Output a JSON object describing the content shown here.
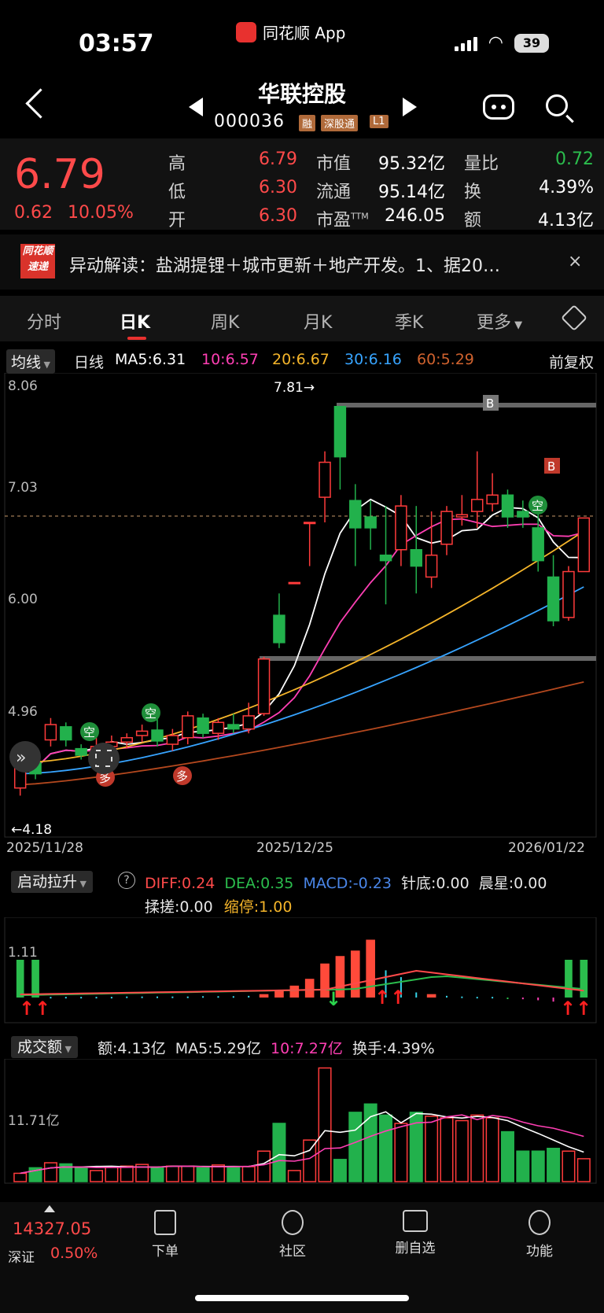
{
  "status_bar": {
    "time": "03:57",
    "app_name": "同花顺 App",
    "battery": "39"
  },
  "header": {
    "stock_name": "华联控股",
    "stock_code": "000036",
    "tags": [
      "融",
      "深股通",
      "L1"
    ]
  },
  "quote": {
    "price": "6.79",
    "change": "0.62",
    "change_pct": "10.05%",
    "fields": [
      {
        "label": "高",
        "value": "6.79",
        "color": "red"
      },
      {
        "label": "低",
        "value": "6.30",
        "color": "red"
      },
      {
        "label": "开",
        "value": "6.30",
        "color": "red"
      },
      {
        "label": "市值",
        "value": "95.32亿",
        "color": "white"
      },
      {
        "label": "流通",
        "value": "95.14亿",
        "color": "white"
      },
      {
        "label": "市盈",
        "sup": "TTM",
        "value": "246.05",
        "color": "white"
      },
      {
        "label": "量比",
        "value": "0.72",
        "color": "green"
      },
      {
        "label": "换",
        "value": "4.39%",
        "color": "white"
      },
      {
        "label": "额",
        "value": "4.13亿",
        "color": "white"
      }
    ]
  },
  "news": {
    "logo_top": "同花顺",
    "logo_bottom": "速递",
    "text": "异动解读：盐湖提锂＋城市更新＋地产开发。1、据20…",
    "close": "×"
  },
  "tabs": [
    "分时",
    "日K",
    "周K",
    "月K",
    "季K",
    "更多"
  ],
  "ma_row": {
    "mode": "均线",
    "period": "日线",
    "ma5": "MA5:6.31",
    "ma10": "10:6.57",
    "ma20": "20:6.67",
    "ma30": "30:6.16",
    "ma60": "60:5.29",
    "adjust": "前复权"
  },
  "kline": {
    "y_labels": [
      "8.06",
      "7.03",
      "6.00",
      "4.96"
    ],
    "high_mark": "7.81→",
    "low_mark": "←4.18",
    "x_labels": [
      "2025/11/28",
      "2025/12/25",
      "2026/01/22"
    ],
    "signals": [
      "空",
      "空",
      "多",
      "多",
      "空",
      "B",
      "B"
    ]
  },
  "chart_data": [
    {
      "type": "candlestick",
      "title": "日K",
      "x": [
        "2025/11/28",
        "2025/12/25",
        "2026/01/22"
      ],
      "ylim": [
        3.9,
        8.06
      ],
      "candles": [
        [
          4.32,
          4.55,
          4.25,
          4.6
        ],
        [
          4.55,
          4.45,
          4.4,
          4.62
        ],
        [
          4.76,
          4.9,
          4.7,
          4.96
        ],
        [
          4.88,
          4.76,
          4.7,
          4.92
        ],
        [
          4.68,
          4.62,
          4.58,
          4.72
        ],
        [
          4.62,
          4.7,
          4.55,
          4.78
        ],
        [
          4.7,
          4.74,
          4.64,
          4.8
        ],
        [
          4.74,
          4.78,
          4.68,
          4.82
        ],
        [
          4.8,
          4.84,
          4.74,
          4.9
        ],
        [
          4.85,
          4.75,
          4.7,
          4.95
        ],
        [
          4.72,
          4.8,
          4.66,
          4.86
        ],
        [
          4.78,
          4.98,
          4.72,
          5.02
        ],
        [
          4.96,
          4.82,
          4.78,
          5.0
        ],
        [
          4.82,
          4.92,
          4.76,
          4.96
        ],
        [
          4.9,
          4.86,
          4.82,
          5.0
        ],
        [
          4.86,
          4.98,
          4.82,
          5.1
        ],
        [
          5.0,
          5.5,
          4.98,
          5.52
        ],
        [
          5.9,
          5.65,
          5.6,
          6.1
        ],
        [
          6.2,
          6.2,
          6.2,
          6.2
        ],
        [
          6.75,
          6.75,
          6.35,
          6.75
        ],
        [
          6.98,
          7.3,
          6.75,
          7.4
        ],
        [
          7.81,
          7.35,
          7.05,
          7.81
        ],
        [
          6.95,
          6.7,
          6.35,
          7.1
        ],
        [
          6.8,
          6.7,
          6.5,
          6.95
        ],
        [
          6.45,
          6.4,
          6.0,
          6.9
        ],
        [
          6.5,
          6.9,
          6.35,
          7.0
        ],
        [
          6.5,
          6.35,
          6.1,
          6.9
        ],
        [
          6.25,
          6.45,
          6.15,
          6.85
        ],
        [
          6.55,
          6.85,
          6.45,
          6.9
        ],
        [
          6.8,
          6.82,
          6.72,
          7.0
        ],
        [
          6.85,
          6.96,
          6.7,
          7.4
        ],
        [
          6.92,
          7.0,
          6.85,
          7.2
        ],
        [
          7.0,
          6.8,
          6.7,
          7.05
        ],
        [
          6.85,
          6.8,
          6.7,
          6.95
        ],
        [
          6.7,
          6.4,
          6.3,
          6.92
        ],
        [
          6.25,
          5.85,
          5.8,
          6.45
        ],
        [
          5.88,
          6.3,
          5.85,
          6.35
        ],
        [
          6.3,
          6.79,
          6.3,
          6.79
        ]
      ],
      "series": [
        {
          "name": "MA5",
          "color": "#ffffff"
        },
        {
          "name": "10",
          "color": "#ff3fb4"
        },
        {
          "name": "20",
          "color": "#f5b52a"
        },
        {
          "name": "30",
          "color": "#37a4ff"
        },
        {
          "name": "60",
          "color": "#b4481e"
        }
      ]
    },
    {
      "type": "bar",
      "title": "启动拉升",
      "legend": [
        "DIFF:0.24",
        "DEA:0.35",
        "MACD:-0.23",
        "针底:0.00",
        "晨星:0.00",
        "揉搓:0.00",
        "缩停:1.00"
      ],
      "y_label": "1.11",
      "values": [
        1.11,
        1.11,
        0.02,
        0.02,
        0.02,
        0.02,
        0.02,
        0.03,
        0.03,
        0.03,
        0.03,
        0.03,
        0.04,
        0.04,
        0.04,
        0.05,
        0.1,
        0.2,
        0.35,
        0.55,
        1.0,
        1.22,
        1.38,
        1.7,
        0.8,
        0.6,
        0.15,
        0.1,
        0.05,
        0.03,
        0.02,
        0.02,
        -0.03,
        -0.05,
        -0.08,
        -0.12,
        1.11,
        1.11
      ]
    },
    {
      "type": "bar",
      "title": "成交额",
      "legend": [
        "额:4.13亿",
        "MA5:5.29亿",
        "10:7.27亿",
        "换手:4.39%"
      ],
      "y_label": "11.71亿",
      "values": [
        1.5,
        2.5,
        3.4,
        3.2,
        2.6,
        2.0,
        2.7,
        2.8,
        3.1,
        2.5,
        2.8,
        2.8,
        2.5,
        3.0,
        2.6,
        2.7,
        5.5,
        10.5,
        2.0,
        7.5,
        20.5,
        4.0,
        12.5,
        14.0,
        12.0,
        10.5,
        12.5,
        11.8,
        11.5,
        11.0,
        12.0,
        11.5,
        9.0,
        5.5,
        5.5,
        6.0,
        5.5,
        4.13
      ]
    }
  ],
  "indicator_rows": {
    "macd_name": "启动拉升",
    "macd_help": "?",
    "macd_items": [
      {
        "text": "DIFF:0.24",
        "color": "#ff4a4a"
      },
      {
        "text": "DEA:0.35",
        "color": "#2bbd4d"
      },
      {
        "text": "MACD:-0.23",
        "color": "#4a86e8"
      },
      {
        "text": "针底:0.00",
        "color": "#e6e6e6"
      },
      {
        "text": "晨星:0.00",
        "color": "#e6e6e6"
      }
    ],
    "macd_items2": [
      {
        "text": "揉搓:0.00",
        "color": "#e6e6e6"
      },
      {
        "text": "缩停:1.00",
        "color": "#f5b52a"
      }
    ],
    "vol_name": "成交额",
    "vol_items": [
      {
        "text": "额:4.13亿",
        "color": "#e6e6e6"
      },
      {
        "text": "MA5:5.29亿",
        "color": "#e6e6e6"
      },
      {
        "text": "10:7.27亿",
        "color": "#ff3fb4"
      },
      {
        "text": "换手:4.39%",
        "color": "#e6e6e6"
      }
    ]
  },
  "bottom_nav": {
    "index_value": "14327.05",
    "index_name": "深证",
    "index_pct": "0.50%",
    "items": [
      "下单",
      "社区",
      "删自选",
      "功能"
    ]
  }
}
